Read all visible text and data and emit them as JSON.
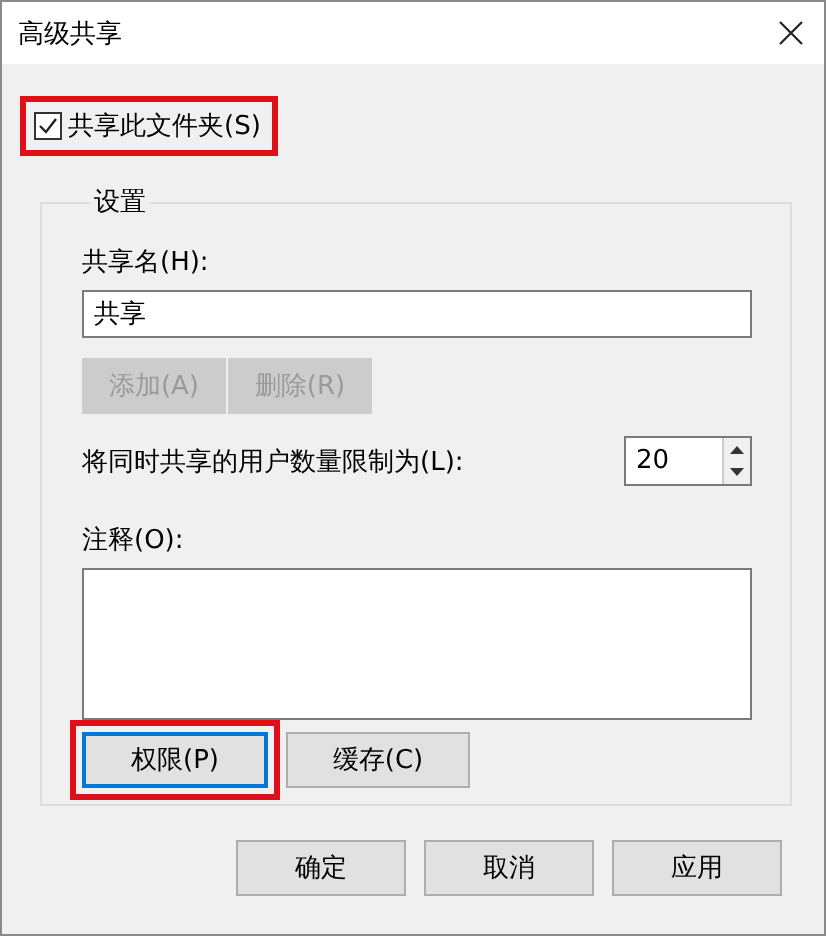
{
  "window": {
    "title": "高级共享"
  },
  "share_checkbox": {
    "label": "共享此文件夹(S)",
    "checked": true,
    "highlighted": true
  },
  "settings": {
    "legend": "设置",
    "share_name": {
      "label": "共享名(H):",
      "value": "共享"
    },
    "name_buttons": [
      {
        "label": "添加(A)",
        "disabled": true
      },
      {
        "label": "删除(R)",
        "disabled": true
      }
    ],
    "user_limit": {
      "label": "将同时共享的用户数量限制为(L):",
      "value": "20"
    },
    "comment": {
      "label": "注释(O):"
    },
    "action_buttons": [
      {
        "label": "权限(P)",
        "focused": true,
        "highlighted": true
      },
      {
        "label": "缓存(C)",
        "focused": false,
        "highlighted": false
      }
    ]
  },
  "footer_buttons": [
    {
      "label": "确定"
    },
    {
      "label": "取消"
    },
    {
      "label": "应用"
    }
  ]
}
